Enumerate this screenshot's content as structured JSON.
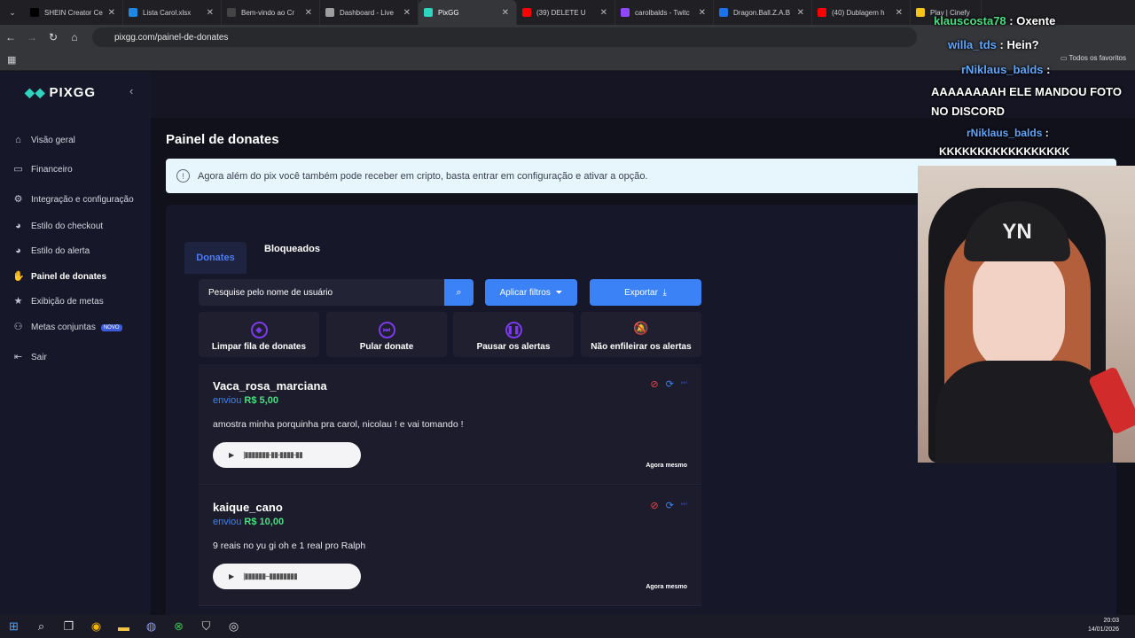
{
  "browser": {
    "tabs": [
      {
        "label": "SHEIN Creator Ce",
        "color": "#000000"
      },
      {
        "label": "Lista Carol.xlsx",
        "color": "#1e88e5"
      },
      {
        "label": "Bem-vindo ao Cr",
        "color": "#444444"
      },
      {
        "label": "Dashboard - Live",
        "color": "#9e9e9e"
      },
      {
        "label": "PixGG",
        "color": "#2dd4bf",
        "active": true
      },
      {
        "label": "(39) DELETE U",
        "color": "#ff0000"
      },
      {
        "label": "carolbalds - Twitc",
        "color": "#9146ff"
      },
      {
        "label": "Dragon.Ball.Z.A.B",
        "color": "#1a73e8"
      },
      {
        "label": "(40) Dublagem h",
        "color": "#ff0000"
      },
      {
        "label": "Play | Cinefy",
        "color": "#f5c518"
      }
    ],
    "url": "pixgg.com/painel-de-donates",
    "bookmarks_label": "Todos os favoritos"
  },
  "sidebar": {
    "brand": "PIXGG",
    "items": [
      {
        "label": "Visão geral",
        "icon": "home-icon"
      },
      {
        "label": "Financeiro",
        "icon": "wallet-icon"
      },
      {
        "label": "Integração e configuração",
        "icon": "gear-icon"
      },
      {
        "label": "Estilo do checkout",
        "icon": "palette-icon"
      },
      {
        "label": "Estilo do alerta",
        "icon": "palette-icon"
      },
      {
        "label": "Painel de donates",
        "icon": "hand-coin-icon",
        "active": true
      },
      {
        "label": "Exibição de metas",
        "icon": "star-icon"
      },
      {
        "label": "Metas conjuntas",
        "icon": "people-icon",
        "badge": "NOVO"
      },
      {
        "label": "Sair",
        "icon": "logout-icon"
      }
    ]
  },
  "main": {
    "title": "Painel de donates",
    "alert": "Agora além do pix você também pode receber em cripto, basta entrar em configuração e ativar a opção.",
    "tabs": [
      "Donates",
      "Bloqueados"
    ],
    "search_placeholder": "Pesquise pelo nome de usuário",
    "filter_label": "Aplicar filtros",
    "export_label": "Exportar",
    "actions": [
      {
        "label": "Limpar fila de donates",
        "icon": "eraser-icon"
      },
      {
        "label": "Pular donate",
        "icon": "skip-icon"
      },
      {
        "label": "Pausar os alertas",
        "icon": "pause-icon"
      },
      {
        "label": "Não enfileirar os alertas",
        "icon": "bell-off-icon"
      }
    ],
    "donates": [
      {
        "user": "Vaca_rosa_marciana",
        "sent": "enviou",
        "amount": "R$ 5,00",
        "message": "amostra minha porquinha pra carol, nicolau ! e vai tomando !",
        "time": "Agora mesmo"
      },
      {
        "user": "kaique_cano",
        "sent": "enviou",
        "amount": "R$ 10,00",
        "message": "9 reais no yu gi oh e 1 real pro Ralph",
        "time": "Agora mesmo"
      }
    ]
  },
  "overlay": {
    "chat": [
      {
        "user": "klauscosta78",
        "text": "Oxente",
        "color": "#4ade80"
      },
      {
        "user": "willa_tds",
        "text": "Hein?",
        "color": "#60a5fa"
      },
      {
        "user": "rNiklaus_balds",
        "text": "AAAAAAAAH ELE MANDOU FOTO NO DISCORD",
        "color": "#60a5fa"
      },
      {
        "user": "rNiklaus_balds",
        "text": "KKKKKKKKKKKKKKKKK",
        "color": "#60a5fa"
      }
    ],
    "cap_text": "YN"
  },
  "taskbar": {
    "time": "20:03",
    "date": "14/01/2026"
  }
}
